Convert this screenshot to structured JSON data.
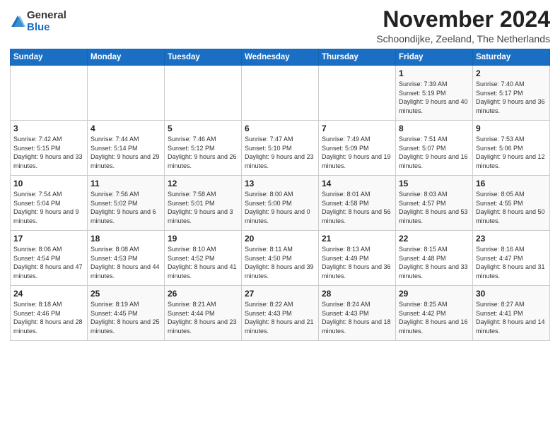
{
  "logo": {
    "general": "General",
    "blue": "Blue"
  },
  "title": "November 2024",
  "location": "Schoondijke, Zeeland, The Netherlands",
  "weekdays": [
    "Sunday",
    "Monday",
    "Tuesday",
    "Wednesday",
    "Thursday",
    "Friday",
    "Saturday"
  ],
  "weeks": [
    [
      {
        "day": "",
        "sunrise": "",
        "sunset": "",
        "daylight": ""
      },
      {
        "day": "",
        "sunrise": "",
        "sunset": "",
        "daylight": ""
      },
      {
        "day": "",
        "sunrise": "",
        "sunset": "",
        "daylight": ""
      },
      {
        "day": "",
        "sunrise": "",
        "sunset": "",
        "daylight": ""
      },
      {
        "day": "",
        "sunrise": "",
        "sunset": "",
        "daylight": ""
      },
      {
        "day": "1",
        "sunrise": "Sunrise: 7:39 AM",
        "sunset": "Sunset: 5:19 PM",
        "daylight": "Daylight: 9 hours and 40 minutes."
      },
      {
        "day": "2",
        "sunrise": "Sunrise: 7:40 AM",
        "sunset": "Sunset: 5:17 PM",
        "daylight": "Daylight: 9 hours and 36 minutes."
      }
    ],
    [
      {
        "day": "3",
        "sunrise": "Sunrise: 7:42 AM",
        "sunset": "Sunset: 5:15 PM",
        "daylight": "Daylight: 9 hours and 33 minutes."
      },
      {
        "day": "4",
        "sunrise": "Sunrise: 7:44 AM",
        "sunset": "Sunset: 5:14 PM",
        "daylight": "Daylight: 9 hours and 29 minutes."
      },
      {
        "day": "5",
        "sunrise": "Sunrise: 7:46 AM",
        "sunset": "Sunset: 5:12 PM",
        "daylight": "Daylight: 9 hours and 26 minutes."
      },
      {
        "day": "6",
        "sunrise": "Sunrise: 7:47 AM",
        "sunset": "Sunset: 5:10 PM",
        "daylight": "Daylight: 9 hours and 23 minutes."
      },
      {
        "day": "7",
        "sunrise": "Sunrise: 7:49 AM",
        "sunset": "Sunset: 5:09 PM",
        "daylight": "Daylight: 9 hours and 19 minutes."
      },
      {
        "day": "8",
        "sunrise": "Sunrise: 7:51 AM",
        "sunset": "Sunset: 5:07 PM",
        "daylight": "Daylight: 9 hours and 16 minutes."
      },
      {
        "day": "9",
        "sunrise": "Sunrise: 7:53 AM",
        "sunset": "Sunset: 5:06 PM",
        "daylight": "Daylight: 9 hours and 12 minutes."
      }
    ],
    [
      {
        "day": "10",
        "sunrise": "Sunrise: 7:54 AM",
        "sunset": "Sunset: 5:04 PM",
        "daylight": "Daylight: 9 hours and 9 minutes."
      },
      {
        "day": "11",
        "sunrise": "Sunrise: 7:56 AM",
        "sunset": "Sunset: 5:02 PM",
        "daylight": "Daylight: 9 hours and 6 minutes."
      },
      {
        "day": "12",
        "sunrise": "Sunrise: 7:58 AM",
        "sunset": "Sunset: 5:01 PM",
        "daylight": "Daylight: 9 hours and 3 minutes."
      },
      {
        "day": "13",
        "sunrise": "Sunrise: 8:00 AM",
        "sunset": "Sunset: 5:00 PM",
        "daylight": "Daylight: 9 hours and 0 minutes."
      },
      {
        "day": "14",
        "sunrise": "Sunrise: 8:01 AM",
        "sunset": "Sunset: 4:58 PM",
        "daylight": "Daylight: 8 hours and 56 minutes."
      },
      {
        "day": "15",
        "sunrise": "Sunrise: 8:03 AM",
        "sunset": "Sunset: 4:57 PM",
        "daylight": "Daylight: 8 hours and 53 minutes."
      },
      {
        "day": "16",
        "sunrise": "Sunrise: 8:05 AM",
        "sunset": "Sunset: 4:55 PM",
        "daylight": "Daylight: 8 hours and 50 minutes."
      }
    ],
    [
      {
        "day": "17",
        "sunrise": "Sunrise: 8:06 AM",
        "sunset": "Sunset: 4:54 PM",
        "daylight": "Daylight: 8 hours and 47 minutes."
      },
      {
        "day": "18",
        "sunrise": "Sunrise: 8:08 AM",
        "sunset": "Sunset: 4:53 PM",
        "daylight": "Daylight: 8 hours and 44 minutes."
      },
      {
        "day": "19",
        "sunrise": "Sunrise: 8:10 AM",
        "sunset": "Sunset: 4:52 PM",
        "daylight": "Daylight: 8 hours and 41 minutes."
      },
      {
        "day": "20",
        "sunrise": "Sunrise: 8:11 AM",
        "sunset": "Sunset: 4:50 PM",
        "daylight": "Daylight: 8 hours and 39 minutes."
      },
      {
        "day": "21",
        "sunrise": "Sunrise: 8:13 AM",
        "sunset": "Sunset: 4:49 PM",
        "daylight": "Daylight: 8 hours and 36 minutes."
      },
      {
        "day": "22",
        "sunrise": "Sunrise: 8:15 AM",
        "sunset": "Sunset: 4:48 PM",
        "daylight": "Daylight: 8 hours and 33 minutes."
      },
      {
        "day": "23",
        "sunrise": "Sunrise: 8:16 AM",
        "sunset": "Sunset: 4:47 PM",
        "daylight": "Daylight: 8 hours and 31 minutes."
      }
    ],
    [
      {
        "day": "24",
        "sunrise": "Sunrise: 8:18 AM",
        "sunset": "Sunset: 4:46 PM",
        "daylight": "Daylight: 8 hours and 28 minutes."
      },
      {
        "day": "25",
        "sunrise": "Sunrise: 8:19 AM",
        "sunset": "Sunset: 4:45 PM",
        "daylight": "Daylight: 8 hours and 25 minutes."
      },
      {
        "day": "26",
        "sunrise": "Sunrise: 8:21 AM",
        "sunset": "Sunset: 4:44 PM",
        "daylight": "Daylight: 8 hours and 23 minutes."
      },
      {
        "day": "27",
        "sunrise": "Sunrise: 8:22 AM",
        "sunset": "Sunset: 4:43 PM",
        "daylight": "Daylight: 8 hours and 21 minutes."
      },
      {
        "day": "28",
        "sunrise": "Sunrise: 8:24 AM",
        "sunset": "Sunset: 4:43 PM",
        "daylight": "Daylight: 8 hours and 18 minutes."
      },
      {
        "day": "29",
        "sunrise": "Sunrise: 8:25 AM",
        "sunset": "Sunset: 4:42 PM",
        "daylight": "Daylight: 8 hours and 16 minutes."
      },
      {
        "day": "30",
        "sunrise": "Sunrise: 8:27 AM",
        "sunset": "Sunset: 4:41 PM",
        "daylight": "Daylight: 8 hours and 14 minutes."
      }
    ]
  ]
}
